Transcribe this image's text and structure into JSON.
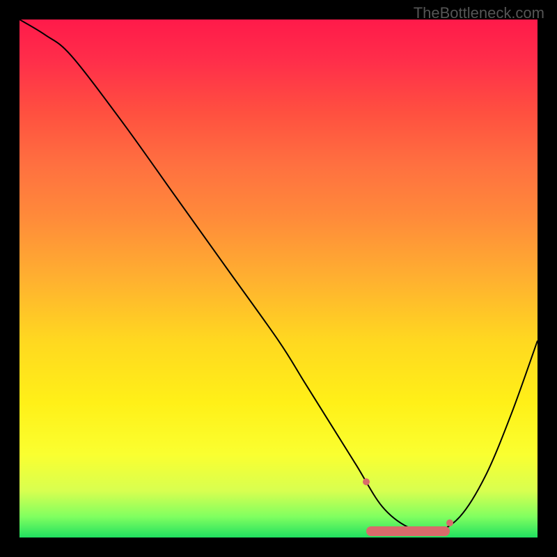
{
  "watermark": "TheBottleneck.com",
  "chart_data": {
    "type": "line",
    "title": "",
    "xlabel": "",
    "ylabel": "",
    "xlim": [
      0,
      100
    ],
    "ylim": [
      0,
      100
    ],
    "series": [
      {
        "name": "curve",
        "x": [
          0,
          5,
          10,
          20,
          30,
          40,
          50,
          55,
          60,
          65,
          70,
          75,
          80,
          85,
          90,
          95,
          100
        ],
        "values": [
          100,
          97,
          93,
          80,
          66,
          52,
          38,
          30,
          22,
          14,
          6,
          2,
          1,
          4,
          12,
          24,
          38
        ]
      }
    ],
    "highlight": {
      "x_start": 67,
      "x_end": 83,
      "y": 1
    },
    "gradient": {
      "top": "#ff1a4a",
      "mid": "#ffd020",
      "bottom": "#20e060"
    }
  }
}
